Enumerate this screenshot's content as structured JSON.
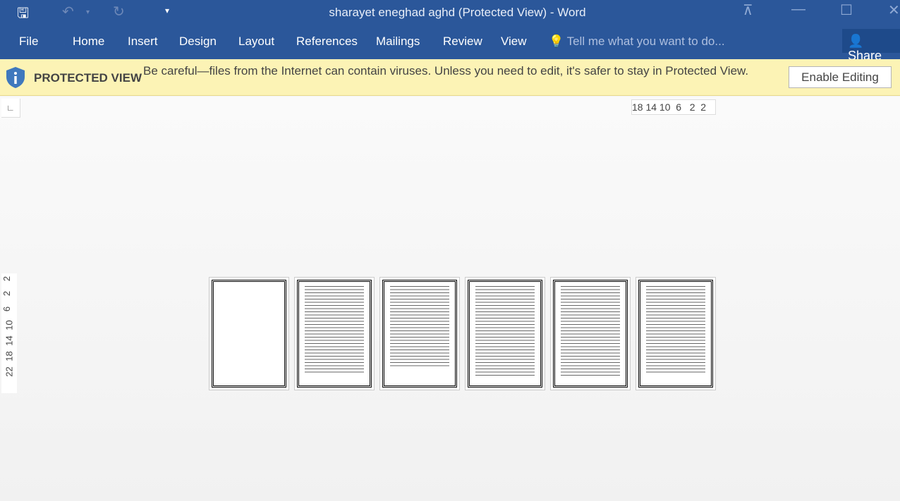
{
  "window": {
    "title": "sharayet eneghad aghd (Protected View) - Word"
  },
  "ribbon": {
    "tabs": [
      "File",
      "Home",
      "Insert",
      "Design",
      "Layout",
      "References",
      "Mailings",
      "Review",
      "View"
    ],
    "tell_me": "Tell me what you want to do...",
    "share": "Share"
  },
  "banner": {
    "label": "PROTECTED VIEW",
    "message": "Be careful—files from the Internet can contain viruses. Unless you need to edit, it's safer to stay in Protected View.",
    "button": "Enable Editing"
  },
  "ruler": {
    "horizontal": "18 14 10  6   2  2",
    "vertical": [
      "2",
      "2",
      "6",
      "10",
      "14",
      "18",
      "22"
    ]
  },
  "pages": [
    {
      "content": "blank"
    },
    {
      "content": "text"
    },
    {
      "content": "text"
    },
    {
      "content": "text"
    },
    {
      "content": "text"
    },
    {
      "content": "text"
    }
  ],
  "colors": {
    "titlebar": "#2b579a",
    "banner": "#fcf3b5"
  }
}
